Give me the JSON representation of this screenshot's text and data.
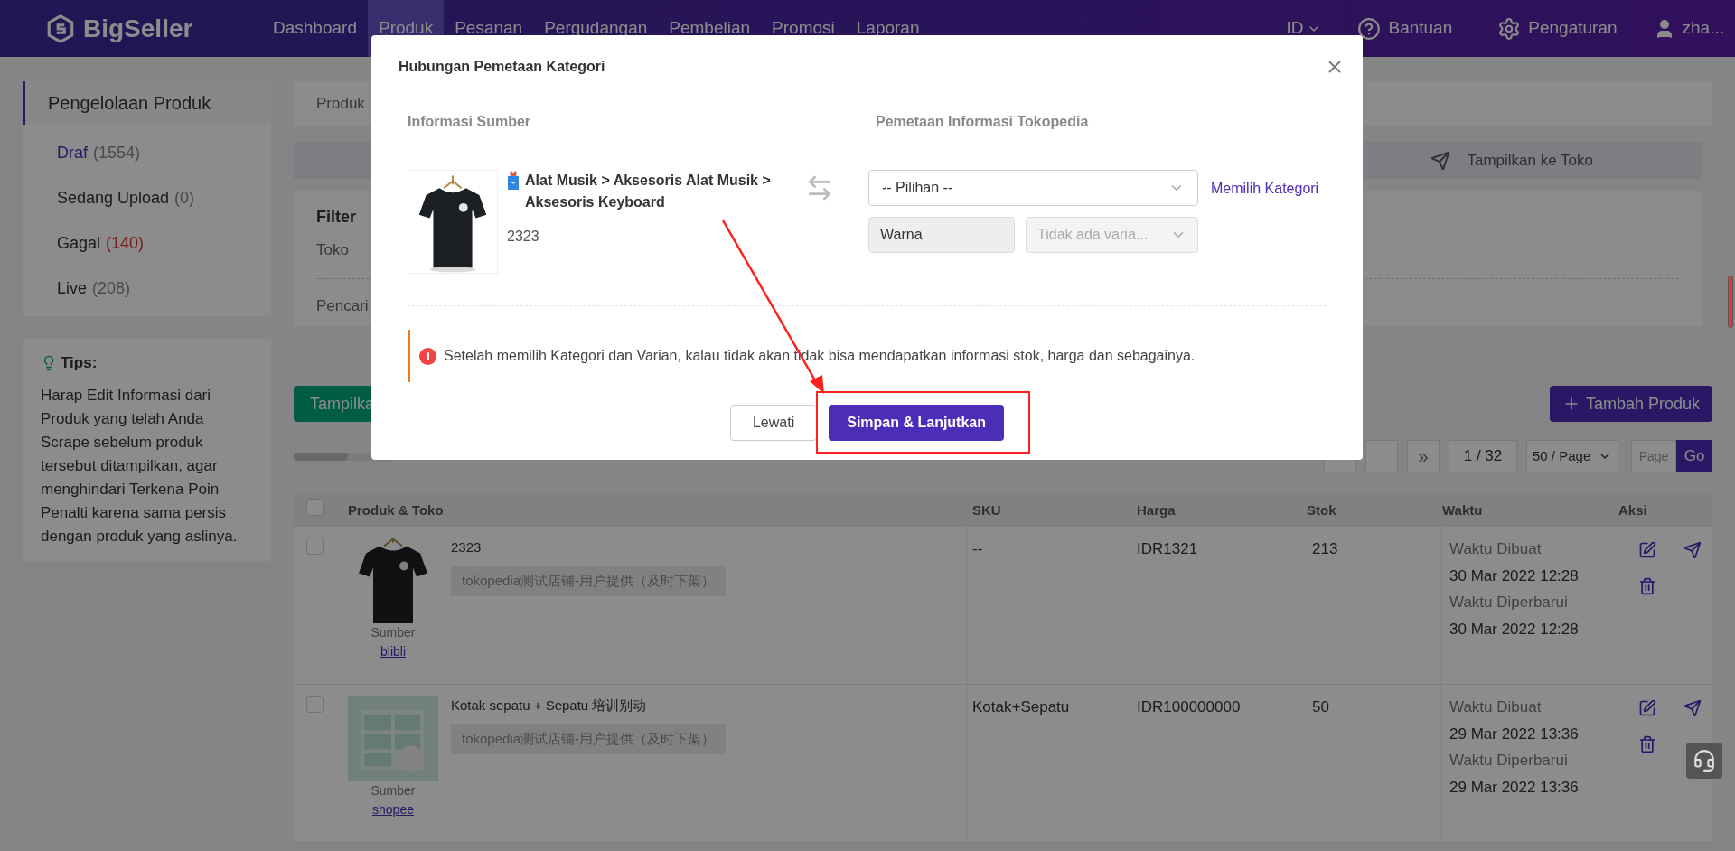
{
  "nav": {
    "logo": "BigSeller",
    "items": [
      {
        "label": "Dashboard",
        "selected": false
      },
      {
        "label": "Produk",
        "selected": true
      },
      {
        "label": "Pesanan",
        "selected": false
      },
      {
        "label": "Pergudangan",
        "selected": false
      },
      {
        "label": "Pembelian",
        "selected": false
      },
      {
        "label": "Promosi",
        "selected": false
      },
      {
        "label": "Laporan",
        "selected": false
      }
    ],
    "language": "ID",
    "help": "Bantuan",
    "settings": "Pengaturan",
    "user": "zha..."
  },
  "sidebar": {
    "title": "Pengelolaan Produk",
    "items": [
      {
        "label": "Draf",
        "count": "(1554)",
        "selected": true,
        "warning": false
      },
      {
        "label": "Sedang Upload",
        "count": "(0)",
        "selected": false,
        "warning": false
      },
      {
        "label": "Gagal",
        "count": "(140)",
        "selected": false,
        "warning": true
      },
      {
        "label": "Live",
        "count": "(208)",
        "selected": false,
        "warning": false
      }
    ],
    "tips": {
      "title": "Tips:",
      "text": "Harap Edit Informasi dari Produk yang telah Anda Scrape sebelum produk tersebut ditampilkan, agar menghindari Terkena Poin Penalti karena sama persis dengan produk yang aslinya."
    }
  },
  "main": {
    "breadcrumb": "Produk",
    "step": "Tampilkan ke Toko",
    "filter": {
      "title": "Filter",
      "labels": [
        "Toko",
        "Pencari"
      ]
    },
    "publish_button": "Tampilka",
    "add_button": "Tambah Produk",
    "pagination": {
      "last": "»",
      "page": "1 / 32",
      "page_size": "50 / Page",
      "page_placeholder": "Page",
      "go": "Go"
    },
    "table": {
      "header_checked": false,
      "columns": [
        "Produk & Toko",
        "SKU",
        "Harga",
        "Stok",
        "Waktu",
        "Aksi"
      ],
      "rows": [
        {
          "checked": false,
          "name": "2323",
          "store": "tokopedia测试店铺-用户提供（及时下架）",
          "source_label": "Sumber",
          "source": "blibli",
          "sku": "--",
          "price": "IDR1321",
          "stock": "213",
          "created_label": "Waktu Dibuat",
          "created": "30 Mar 2022 12:28",
          "updated_label": "Waktu Diperbarui",
          "updated": "30 Mar 2022 12:28"
        },
        {
          "checked": false,
          "name": "Kotak sepatu + Sepatu 培训别动",
          "store": "tokopedia测试店铺-用户提供（及时下架）",
          "source_label": "Sumber",
          "source": "shopee",
          "sku": "Kotak+Sepatu",
          "price": "IDR100000000",
          "stock": "50",
          "created_label": "Waktu Dibuat",
          "created": "29 Mar 2022 13:36",
          "updated_label": "Waktu Diperbarui",
          "updated": "29 Mar 2022 13:36"
        }
      ]
    }
  },
  "modal": {
    "title": "Hubungan Pemetaan Kategori",
    "source_header": "Informasi Sumber",
    "target_header": "Pemetaan Informasi Tokopedia",
    "category_path": "Alat Musik > Aksesoris Alat Musik > Aksesoris Keyboard",
    "product_name": "2323",
    "category_placeholder": "-- Pilihan --",
    "choose_link": "Memilih Kategori",
    "variant_label": "Warna",
    "variant_select": "Tidak ada varia...",
    "warning": "Setelah memilih Kategori dan Varian, kalau tidak akan tidak bisa mendapatkan informasi stok, harga dan sebagainya.",
    "skip_button": "Lewati",
    "save_button": "Simpan & Lanjutkan"
  }
}
